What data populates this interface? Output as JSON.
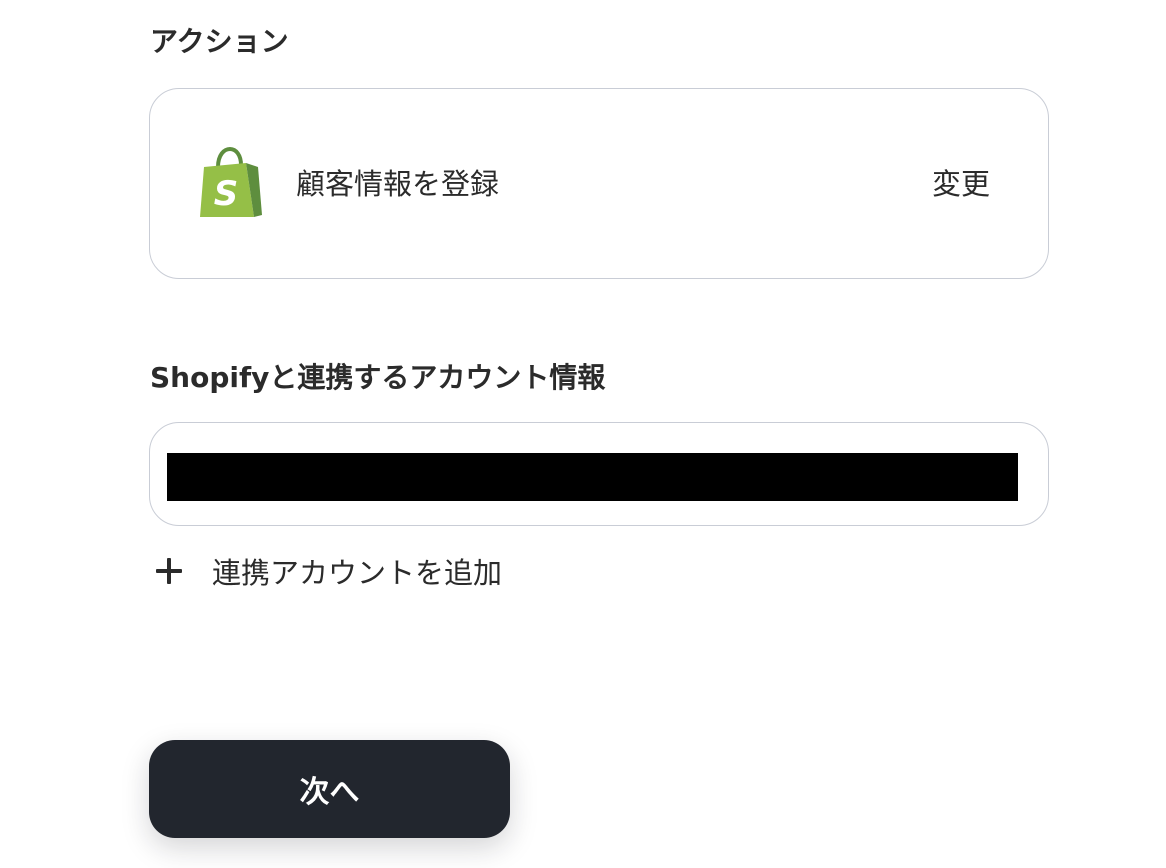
{
  "action_section": {
    "heading": "アクション",
    "card": {
      "app_icon": "shopify-icon",
      "action_label": "顧客情報を登録",
      "change_label": "変更"
    }
  },
  "account_section": {
    "heading": "Shopifyと連携するアカウント情報",
    "add_account_label": "連携アカウントを追加"
  },
  "footer": {
    "next_label": "次へ"
  },
  "colors": {
    "button_bg": "#22262e",
    "border": "#c9cdd6",
    "shopify_green": "#95bf47",
    "shopify_dark_green": "#5e8e3e"
  }
}
